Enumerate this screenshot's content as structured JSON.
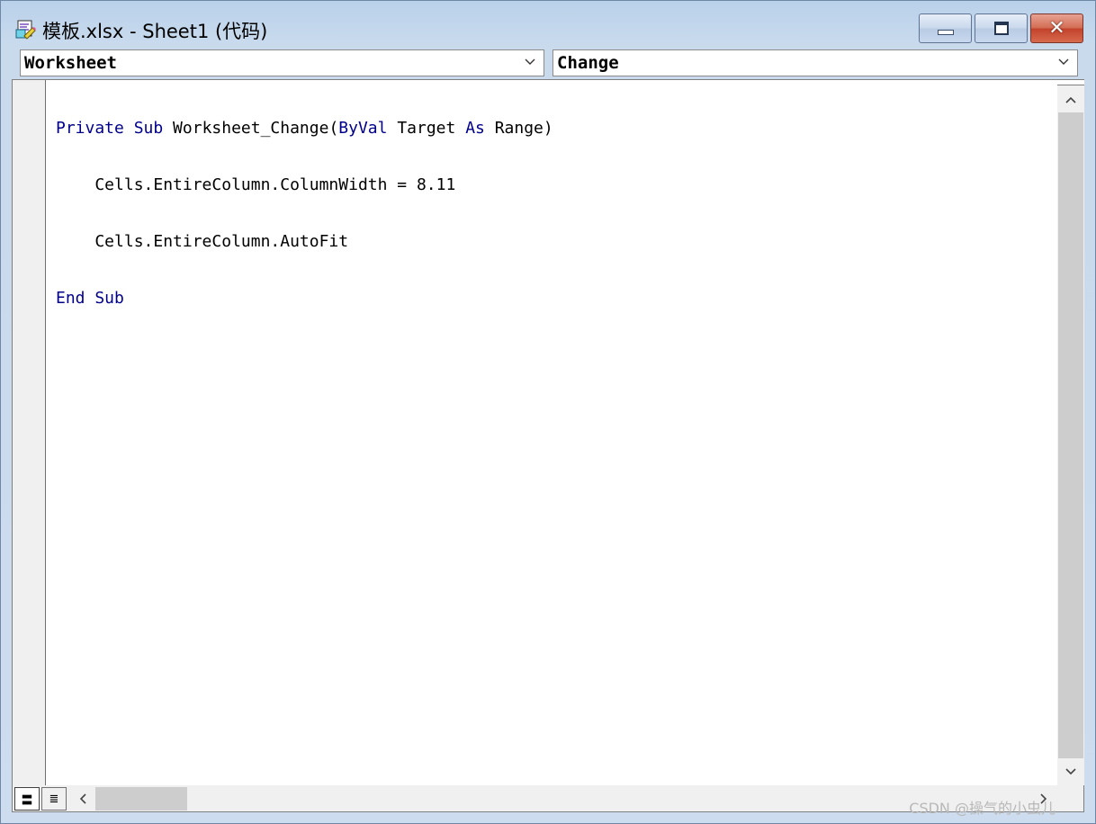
{
  "window": {
    "title": "模板.xlsx - Sheet1 (代码)",
    "icon": "vba-code-module-icon",
    "controls": {
      "minimize": "minimize-icon",
      "maximize": "maximize-icon",
      "close_label": "✕"
    }
  },
  "selectors": {
    "object": "Worksheet",
    "procedure": "Change"
  },
  "code": {
    "line1": {
      "kw1": "Private Sub",
      "text1": " Worksheet_Change(",
      "kw2": "ByVal",
      "text2": " Target ",
      "kw3": "As",
      "text3": " Range)"
    },
    "line2": "    Cells.EntireColumn.ColumnWidth = 8.11",
    "line3": "    Cells.EntireColumn.AutoFit",
    "line4": {
      "kw1": "End Sub"
    }
  },
  "view_buttons": {
    "procedure_view": "〓",
    "full_module_view": "≣"
  },
  "watermark": "CSDN @操气的小虫儿",
  "colors": {
    "keyword": "#00008b",
    "code_text": "#000000",
    "title_bar": "#b9d1ea",
    "close_button": "#c2412a"
  }
}
